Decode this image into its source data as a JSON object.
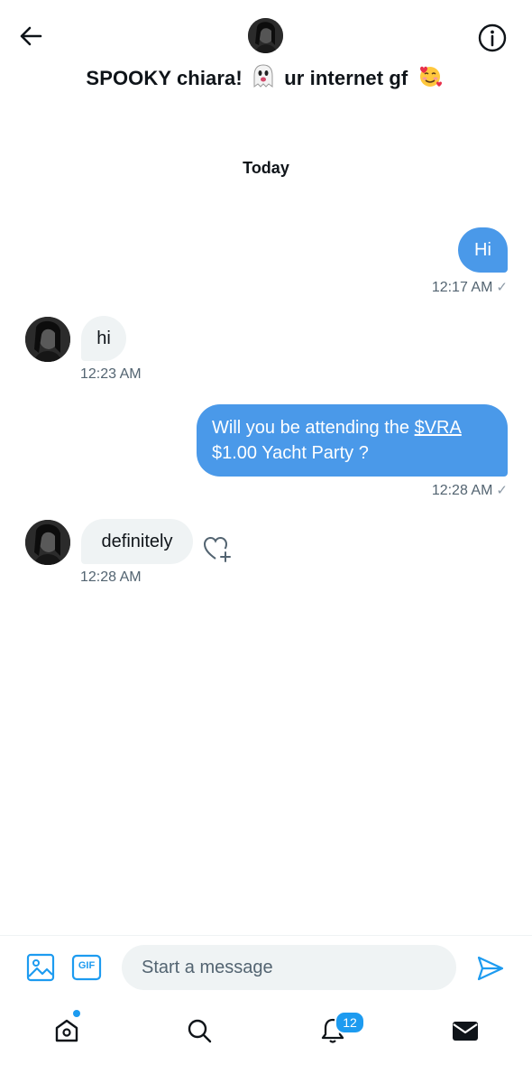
{
  "header": {
    "name_part1": "SPOOKY chiara!",
    "name_part2": "ur internet gf",
    "emoji_ghost": "ghost-emoji",
    "emoji_smiling_hearts": "smiling-face-with-hearts-emoji",
    "back_icon": "arrow-left-icon",
    "info_icon": "info-icon"
  },
  "date_separator": "Today",
  "messages": [
    {
      "direction": "outgoing",
      "text": "Hi",
      "time": "12:17 AM",
      "status": "✓"
    },
    {
      "direction": "incoming",
      "text": "hi",
      "time": "12:23 AM"
    },
    {
      "direction": "outgoing",
      "text_before": "Will you be attending the ",
      "link": "$VRA",
      "text_after": "$1.00 Yacht Party ?",
      "time": "12:28 AM",
      "status": "✓"
    },
    {
      "direction": "incoming",
      "text": "definitely",
      "time": "12:28 AM",
      "reaction_icon": "heart-plus-icon"
    }
  ],
  "composer": {
    "placeholder": "Start a message",
    "media_icon": "image-icon",
    "gif_label": "GIF",
    "send_icon": "send-icon"
  },
  "nav": {
    "home_icon": "home-icon",
    "search_icon": "search-icon",
    "notifications_icon": "bell-icon",
    "notifications_count": "12",
    "messages_icon": "mail-icon"
  },
  "colors": {
    "accent": "#1d9bf0",
    "outgoing_bubble": "#4a99e9",
    "incoming_bubble": "#eff3f4",
    "secondary_text": "#536471"
  }
}
